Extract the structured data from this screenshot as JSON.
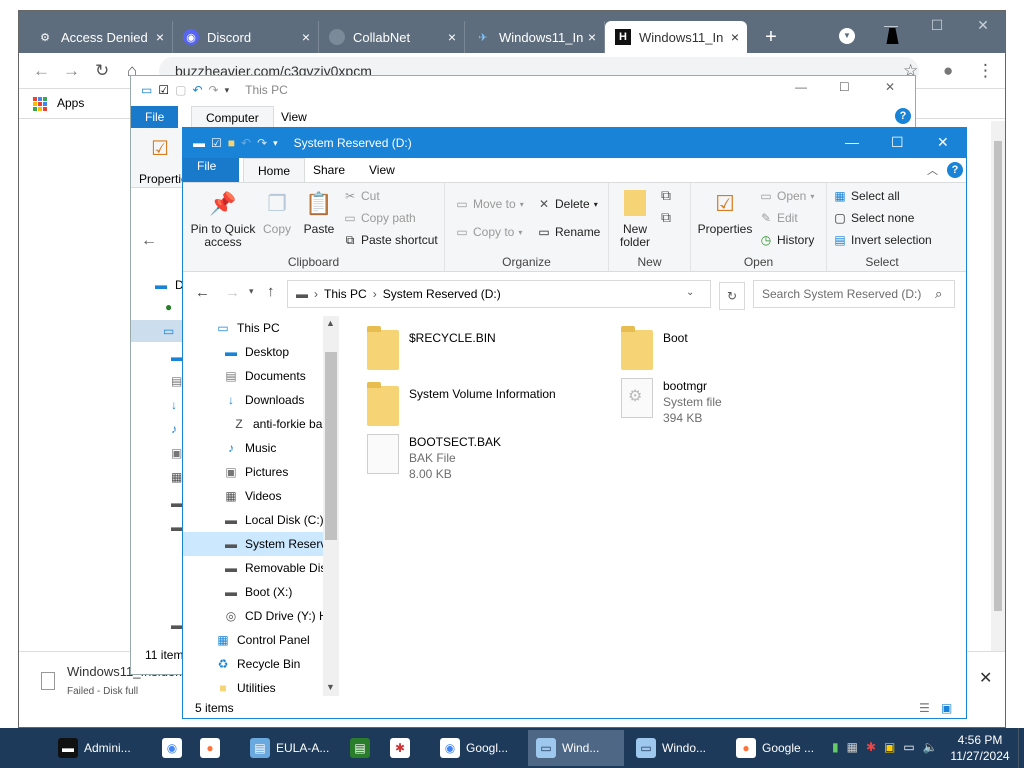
{
  "browser": {
    "tabs": [
      {
        "label": "Access Denied",
        "icon": "gear-person-icon"
      },
      {
        "label": "Discord",
        "icon": "discord-icon"
      },
      {
        "label": "CollabNet",
        "icon": "globe-icon"
      },
      {
        "label": "Windows11_In",
        "icon": "windows-icon"
      },
      {
        "label": "Windows11_In",
        "icon": "h-logo-icon",
        "active": true
      }
    ],
    "url": "buzzheavier.com/c3qvziy0xpcm",
    "bookmarks_apps": "Apps",
    "download_name": "Windows11_Insider...",
    "download_status": "Failed - Disk full",
    "new_tab": "+",
    "close_tab": "×"
  },
  "back_window": {
    "title": "This PC",
    "tabs": [
      "File",
      "Computer",
      "View"
    ],
    "properties": "Properties",
    "items_count": "11 item",
    "nav_letter": "D"
  },
  "explorer": {
    "title": "System Reserved (D:)",
    "tabs": [
      "File",
      "Home",
      "Share",
      "View"
    ],
    "ribbon": {
      "clipboard": {
        "label": "Clipboard",
        "pin": "Pin to Quick access",
        "copy": "Copy",
        "paste": "Paste",
        "cut": "Cut",
        "copy_path": "Copy path",
        "paste_shortcut": "Paste shortcut"
      },
      "organize": {
        "label": "Organize",
        "move_to": "Move to",
        "copy_to": "Copy to",
        "delete": "Delete",
        "rename": "Rename"
      },
      "new": {
        "label": "New",
        "new_folder": "New folder"
      },
      "open": {
        "label": "Open",
        "properties": "Properties",
        "open": "Open",
        "edit": "Edit",
        "history": "History"
      },
      "select": {
        "label": "Select",
        "select_all": "Select all",
        "select_none": "Select none",
        "invert": "Invert selection"
      }
    },
    "address": {
      "crumbs": [
        "This PC",
        "System Reserved (D:)"
      ],
      "search_placeholder": "Search System Reserved (D:)"
    },
    "nav": [
      {
        "label": "This PC",
        "icon": "computer-icon",
        "level": 0
      },
      {
        "label": "Desktop",
        "icon": "desktop-icon",
        "level": 1
      },
      {
        "label": "Documents",
        "icon": "documents-icon",
        "level": 1
      },
      {
        "label": "Downloads",
        "icon": "downloads-icon",
        "level": 1
      },
      {
        "label": "anti-forkie ba",
        "icon": "zip-icon",
        "level": 2
      },
      {
        "label": "Music",
        "icon": "music-icon",
        "level": 1
      },
      {
        "label": "Pictures",
        "icon": "pictures-icon",
        "level": 1
      },
      {
        "label": "Videos",
        "icon": "videos-icon",
        "level": 1
      },
      {
        "label": "Local Disk (C:)",
        "icon": "drive-icon",
        "level": 1
      },
      {
        "label": "System Reserve",
        "icon": "drive-icon",
        "level": 1,
        "selected": true
      },
      {
        "label": "Removable Dis",
        "icon": "drive-icon",
        "level": 1
      },
      {
        "label": "Boot (X:)",
        "icon": "drive-icon",
        "level": 1
      },
      {
        "label": "CD Drive (Y:) H",
        "icon": "cd-drive-icon",
        "level": 1
      },
      {
        "label": "Control Panel",
        "icon": "control-panel-icon",
        "level": 0
      },
      {
        "label": "Recycle Bin",
        "icon": "recycle-bin-icon",
        "level": 0
      },
      {
        "label": "Utilities",
        "icon": "folder-icon",
        "level": 0
      }
    ],
    "files": [
      {
        "name": "$RECYCLE.BIN",
        "type": "folder"
      },
      {
        "name": "Boot",
        "type": "folder"
      },
      {
        "name": "System Volume Information",
        "type": "folder"
      },
      {
        "name": "bootmgr",
        "kind": "System file",
        "size": "394 KB",
        "type": "system"
      },
      {
        "name": "BOOTSECT.BAK",
        "kind": "BAK File",
        "size": "8.00 KB",
        "type": "doc"
      }
    ],
    "status": "5 items"
  },
  "taskbar": {
    "items": [
      {
        "label": "Admini...",
        "icon": "terminal-icon"
      },
      {
        "label": "",
        "icon": "chrome-icon"
      },
      {
        "label": "",
        "icon": "firefox-icon"
      },
      {
        "label": "EULA-A...",
        "icon": "document-icon"
      },
      {
        "label": "",
        "icon": "notepad-icon"
      },
      {
        "label": "",
        "icon": "app-icon"
      },
      {
        "label": "Googl...",
        "icon": "chrome-icon"
      },
      {
        "label": "Wind...",
        "icon": "explorer-icon",
        "active": true
      },
      {
        "label": "Windo...",
        "icon": "explorer-icon"
      },
      {
        "label": "Google ...",
        "icon": "firefox-icon"
      }
    ],
    "time": "4:56 PM",
    "date": "11/27/2024"
  }
}
